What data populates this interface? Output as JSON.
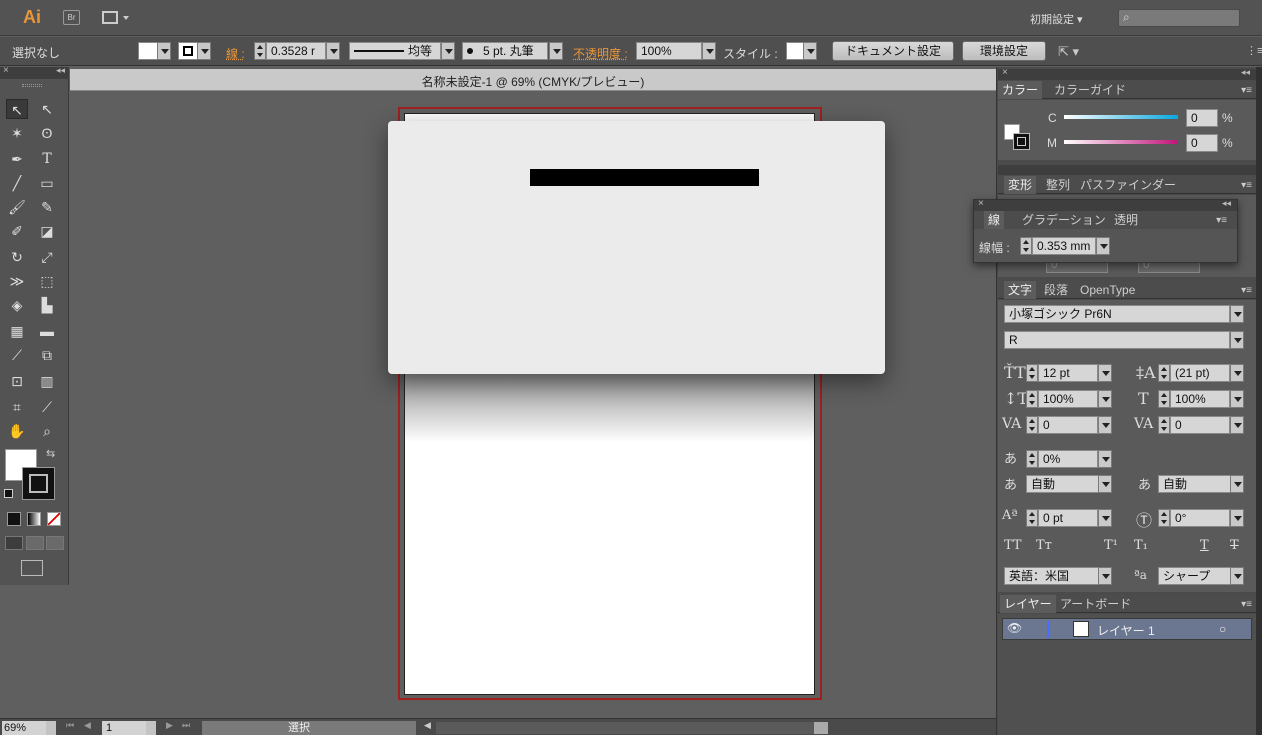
{
  "app": {
    "logo": "Ai",
    "bridge": "Br",
    "workspace": "初期設定",
    "search_placeholder": ""
  },
  "control": {
    "selection": "選択なし",
    "stroke_label": "線 :",
    "stroke_value": "0.3528 r",
    "profile_label": "均等",
    "brush_label": "5 pt. 丸筆",
    "opacity_label": "不透明度 :",
    "opacity_value": "100%",
    "style_label": "スタイル :",
    "doc_settings": "ドキュメント設定",
    "prefs": "環境設定"
  },
  "document": {
    "title": "名称未設定-1 @ 69% (CMYK/プレビュー)"
  },
  "status": {
    "zoom": "69%",
    "page": "1",
    "tool": "選択"
  },
  "color_panel": {
    "tabs": [
      "カラー",
      "カラーガイド"
    ],
    "c_label": "C",
    "m_label": "M",
    "c_value": "0",
    "m_value": "0",
    "unit": "%"
  },
  "transform_panel": {
    "tabs": [
      "変形",
      "整列",
      "パスファインダー"
    ],
    "w_value": "0",
    "h_value": "0"
  },
  "stroke_panel": {
    "tabs": [
      "線",
      "グラデーション",
      "透明"
    ],
    "weight_label": "線幅 :",
    "weight_value": "0.353 mm"
  },
  "char_panel": {
    "tabs": [
      "文字",
      "段落",
      "OpenType"
    ],
    "font": "小塚ゴシック Pr6N",
    "style": "R",
    "size": "12 pt",
    "leading": "(21 pt)",
    "vscale": "100%",
    "hscale": "100%",
    "kerning": "0",
    "tracking": "0",
    "tsume": "0%",
    "aki_left": "自動",
    "aki_right": "自動",
    "baseline": "0 pt",
    "rotation": "0°",
    "language": "英語：米国",
    "antialias": "シャープ"
  },
  "layers_panel": {
    "tabs": [
      "レイヤー",
      "アートボード"
    ],
    "layer_name": "レイヤー 1"
  }
}
